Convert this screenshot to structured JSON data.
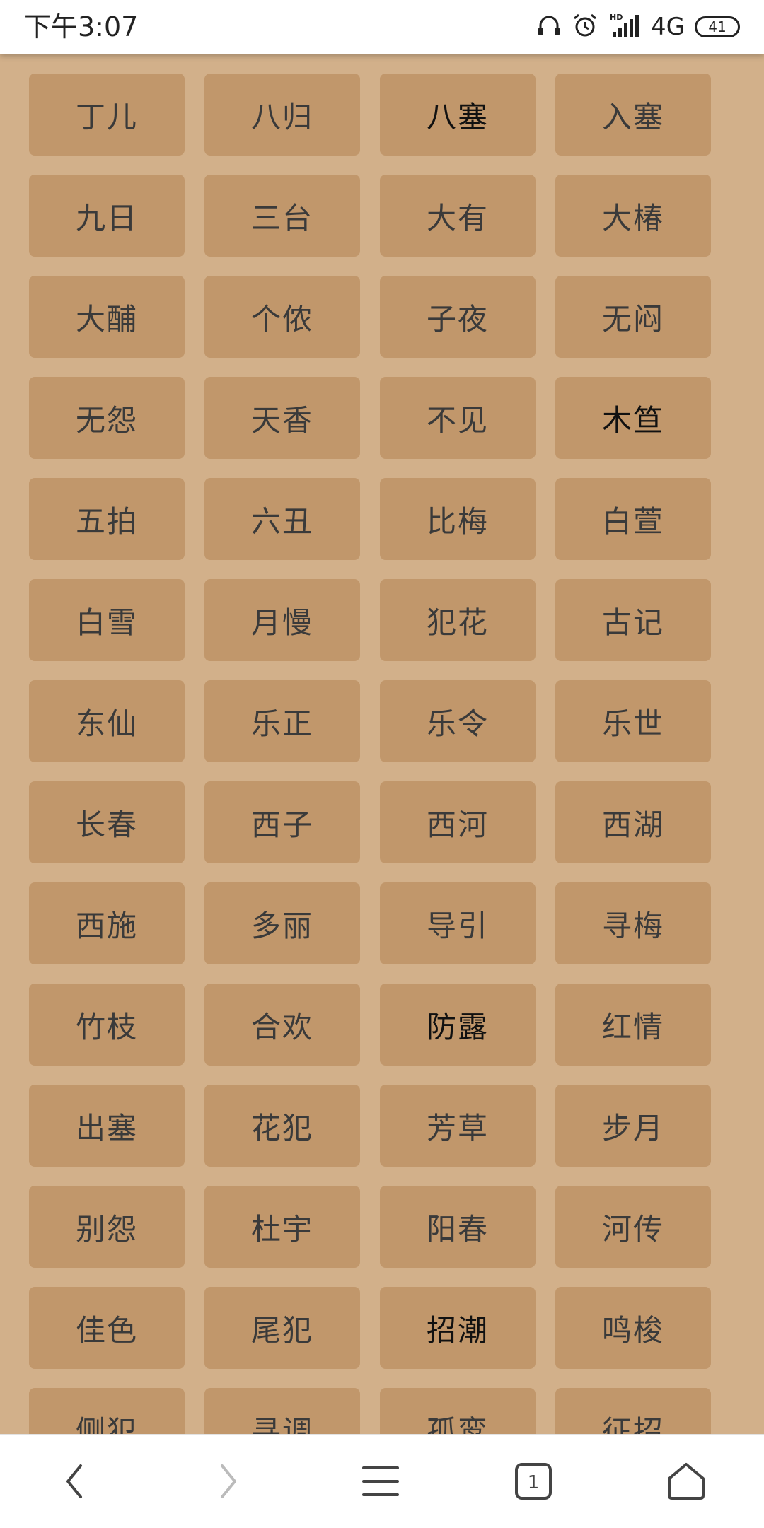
{
  "status_bar": {
    "time": "下午3:07",
    "network": "4G",
    "battery": "41",
    "icons": [
      "headphones-icon",
      "alarm-icon",
      "hd-signal-icon",
      "battery-icon"
    ]
  },
  "tiles": [
    "丁儿",
    "八归",
    "八塞",
    "入塞",
    "九日",
    "三台",
    "大有",
    "大椿",
    "大酺",
    "个侬",
    "子夜",
    "无闷",
    "无怨",
    "天香",
    "不见",
    "木笪",
    "五拍",
    "六丑",
    "比梅",
    "白萱",
    "白雪",
    "月慢",
    "犯花",
    "古记",
    "东仙",
    "乐正",
    "乐令",
    "乐世",
    "长春",
    "西子",
    "西河",
    "西湖",
    "西施",
    "多丽",
    "导引",
    "寻梅",
    "竹枝",
    "合欢",
    "防露",
    "红情",
    "出塞",
    "花犯",
    "芳草",
    "步月",
    "别怨",
    "杜宇",
    "阳春",
    "河传",
    "佳色",
    "尾犯",
    "招潮",
    "鸣梭",
    "侧犯",
    "寻调",
    "孤鸾",
    "征招"
  ],
  "nav_bar": {
    "tab_count": "1",
    "icons": [
      "back-icon",
      "forward-icon",
      "menu-icon",
      "tabs-icon",
      "home-icon"
    ]
  },
  "colors": {
    "page_background": "#d2b08a",
    "tile_background": "#c1976b",
    "tile_text": "#3a3a3a"
  }
}
